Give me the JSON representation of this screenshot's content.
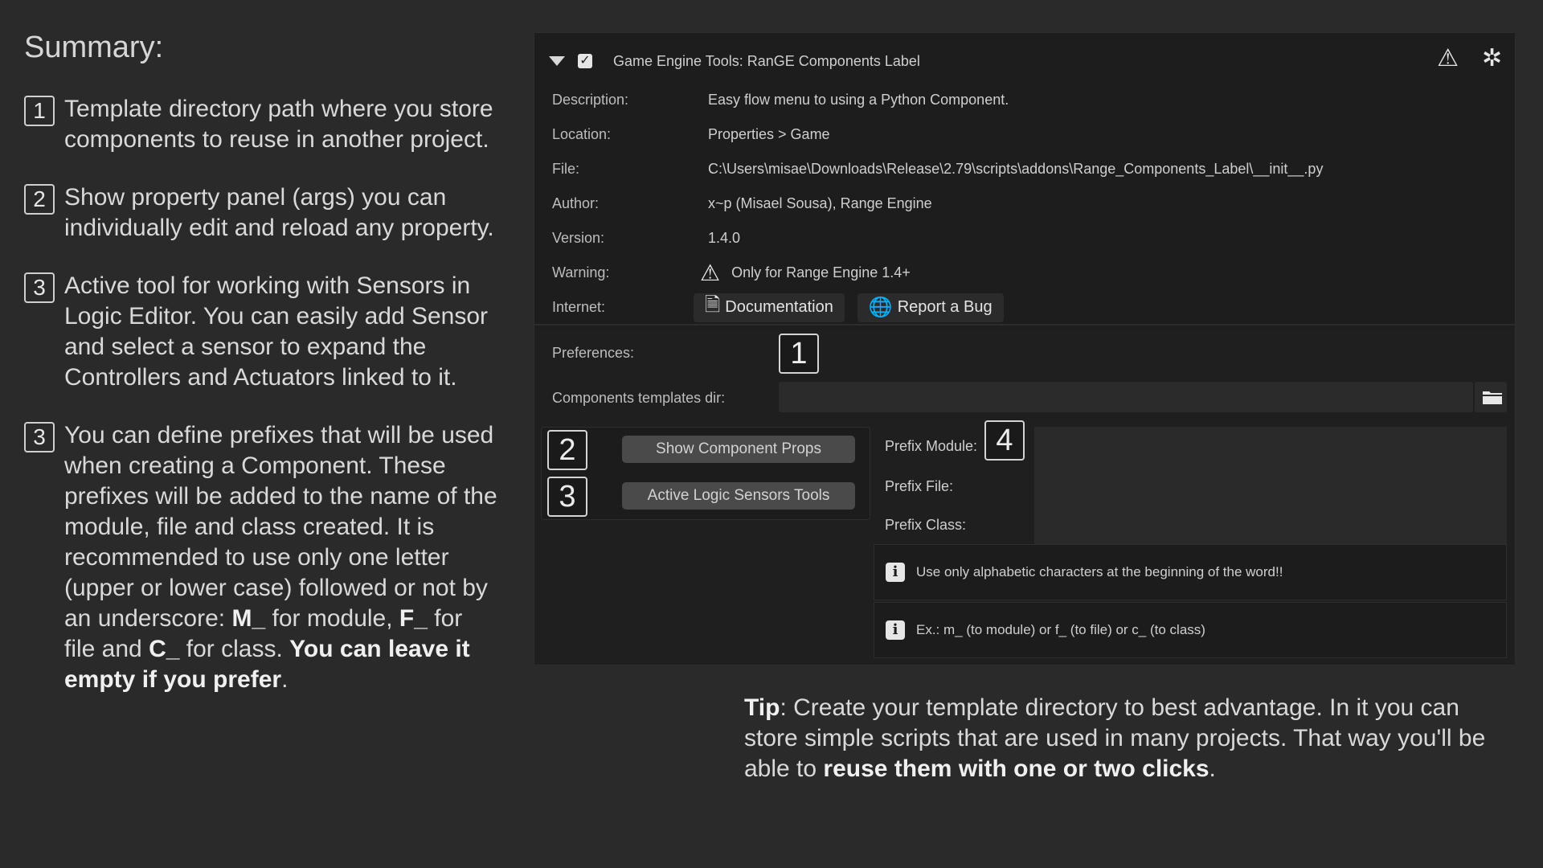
{
  "summary": {
    "title": "Summary:",
    "items": [
      {
        "num": "1",
        "text": "Template directory path where you store components to reuse in another project."
      },
      {
        "num": "2",
        "text": "Show property panel (args) you can individually edit and reload any property."
      },
      {
        "num": "3",
        "text": "Active tool for working with Sensors in Logic Editor. You can easily add Sensor and select a sensor to expand the Controllers and Actuators linked to it."
      },
      {
        "num": "3",
        "text_a": "You can define prefixes that will be used when creating a Component. These prefixes will be added to the name of the module, file and class created. It is recommended to use only one letter (upper or lower case) followed or not by an underscore: ",
        "b1": "M_",
        "text_b": " for module, ",
        "b2": "F_",
        "text_c": " for file and ",
        "b3": "C_",
        "text_d": " for class. ",
        "b4": "You can leave it empty if you prefer",
        "text_e": "."
      }
    ]
  },
  "panel": {
    "header_title": "Game Engine Tools: RanGE Components Label",
    "info": {
      "description_label": "Description:",
      "description_value": "Easy flow menu to using a Python Component.",
      "location_label": "Location:",
      "location_value": "Properties > Game",
      "file_label": "File:",
      "file_value": "C:\\Users\\misae\\Downloads\\Release\\2.79\\scripts\\addons\\Range_Components_Label\\__init__.py",
      "author_label": "Author:",
      "author_value": "x~p (Misael Sousa), Range Engine",
      "version_label": "Version:",
      "version_value": "1.4.0",
      "warning_label": "Warning:",
      "warning_value": "Only for Range Engine 1.4+",
      "internet_label": "Internet:",
      "documentation_label": "Documentation",
      "report_bug_label": "Report a Bug"
    },
    "prefs": {
      "preferences_label": "Preferences:",
      "templates_dir_label": "Components templates dir:",
      "templates_dir_value": "",
      "show_props_label": "Show Component Props",
      "logic_tools_label": "Active Logic Sensors Tools",
      "prefix_module_label": "Prefix Module:",
      "prefix_file_label": "Prefix File:",
      "prefix_class_label": "Prefix Class:",
      "note_1": "Use only alphabetic characters at the beginning of the word!!",
      "note_2": "Ex.: m_ (to module) or f_ (to file) or c_ (to class)"
    },
    "callouts": {
      "c1": "1",
      "c2": "2",
      "c3": "3",
      "c4": "4"
    }
  },
  "tip": {
    "lead": "Tip",
    "text_a": ": Create your template directory to best advantage. In it you can store simple scripts that are used in many projects. That way you'll be able to ",
    "bold": "reuse them with one or two clicks",
    "text_b": "."
  },
  "icons": {
    "collapse": "triangle-down-icon",
    "enabled": "checkbox-icon",
    "warning": "warning-triangle-icon",
    "person": "person-icon",
    "documentation": "document-icon",
    "report": "globe-icon",
    "folder": "folder-icon",
    "info": "info-icon"
  }
}
